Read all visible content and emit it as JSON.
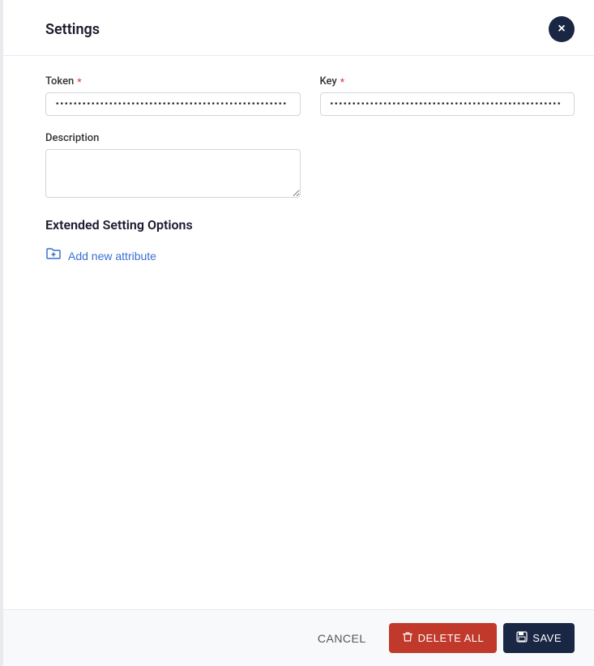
{
  "modal": {
    "title": "Settings",
    "close_button_label": "×"
  },
  "form": {
    "token": {
      "label": "Token",
      "required": true,
      "value": "••••••••••••••••••••••••••••••••••••••••••••••••••••",
      "placeholder": ""
    },
    "key": {
      "label": "Key",
      "required": true,
      "value": "••••••••••••••••••••••••••••••••••••••••••••••••••••",
      "placeholder": ""
    },
    "description": {
      "label": "Description",
      "required": false,
      "value": "",
      "placeholder": ""
    }
  },
  "extended_settings": {
    "section_title": "Extended Setting Options",
    "add_attribute_label": "Add new attribute"
  },
  "footer": {
    "cancel_label": "CANCEL",
    "delete_label": "DELETE ALL",
    "save_label": "SAVE"
  },
  "icons": {
    "close": "×",
    "folder": "📁",
    "trash": "🗑",
    "save": "💾"
  }
}
